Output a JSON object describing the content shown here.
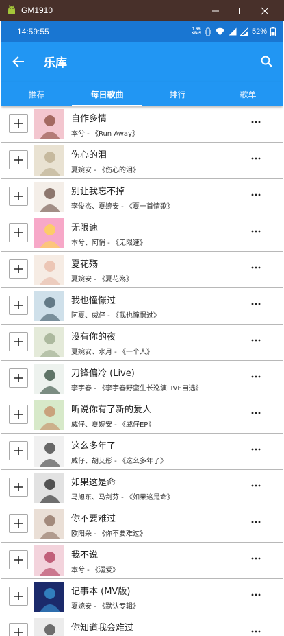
{
  "window": {
    "title": "GM1910"
  },
  "status_bar": {
    "time": "14:59:55",
    "net_speed_value": "1.66",
    "net_speed_unit": "KB/S",
    "battery": "52%"
  },
  "app_bar": {
    "title": "乐库"
  },
  "tabs": [
    {
      "label": "推荐",
      "active": false
    },
    {
      "label": "每日歌曲",
      "active": true
    },
    {
      "label": "排行",
      "active": false
    },
    {
      "label": "歌单",
      "active": false
    }
  ],
  "songs": [
    {
      "title": "自作多情",
      "subtitle": "本兮 - 《Run Away》",
      "cover_colors": [
        "#f3c6cf",
        "#8a4a3c"
      ]
    },
    {
      "title": "伤心的泪",
      "subtitle": "夏婉安 - 《伤心的泪》",
      "cover_colors": [
        "#e9e2d2",
        "#b9ab8c"
      ]
    },
    {
      "title": "别让我忘不掉",
      "subtitle": "李俊杰、夏婉安 - 《夏一首情歌》",
      "cover_colors": [
        "#f4eee8",
        "#6b4f45"
      ]
    },
    {
      "title": "无限速",
      "subtitle": "本兮、阿悄 - 《无限速》",
      "cover_colors": [
        "#f7a8c8",
        "#ffd84a"
      ]
    },
    {
      "title": "夏花殇",
      "subtitle": "夏婉安 - 《夏花殇》",
      "cover_colors": [
        "#f6ece4",
        "#e8b9a6"
      ]
    },
    {
      "title": "我也憧憬过",
      "subtitle": "阿夏、威仔 - 《我也憧憬过》",
      "cover_colors": [
        "#cfe0ea",
        "#3f5866"
      ]
    },
    {
      "title": "没有你的夜",
      "subtitle": "夏婉安、水月 - 《一个人》",
      "cover_colors": [
        "#e4ead9",
        "#9aa88a"
      ]
    },
    {
      "title": "刀锋偏冷 (Live)",
      "subtitle": "李宇春 - 《李宇春野蛮生长巡演LIVE自选》",
      "cover_colors": [
        "#edf2ee",
        "#2f4a3a"
      ]
    },
    {
      "title": "听说你有了新的爱人",
      "subtitle": "威仔、夏婉安 - 《威仔EP》",
      "cover_colors": [
        "#d7e9c9",
        "#c48a62"
      ]
    },
    {
      "title": "这么多年了",
      "subtitle": "威仔、胡艾彤 - 《这么多年了》",
      "cover_colors": [
        "#f0f0f0",
        "#3b3b3b"
      ]
    },
    {
      "title": "如果这是命",
      "subtitle": "马旭东、马剑芬 - 《如果这是命》",
      "cover_colors": [
        "#e2e2e2",
        "#222222"
      ]
    },
    {
      "title": "你不要难过",
      "subtitle": "欧阳朵 - 《你不要难过》",
      "cover_colors": [
        "#eadfd6",
        "#8b6e5e"
      ]
    },
    {
      "title": "我不说",
      "subtitle": "本兮 - 《溺爱》",
      "cover_colors": [
        "#f3d3dc",
        "#b03a5a"
      ]
    },
    {
      "title": "记事本 (MV版)",
      "subtitle": "夏婉安 - 《默认专辑》",
      "cover_colors": [
        "#1b2a6b",
        "#3a9bd8"
      ]
    },
    {
      "title": "你知道我会难过",
      "subtitle": "",
      "cover_colors": [
        "#ececec",
        "#444444"
      ]
    }
  ]
}
